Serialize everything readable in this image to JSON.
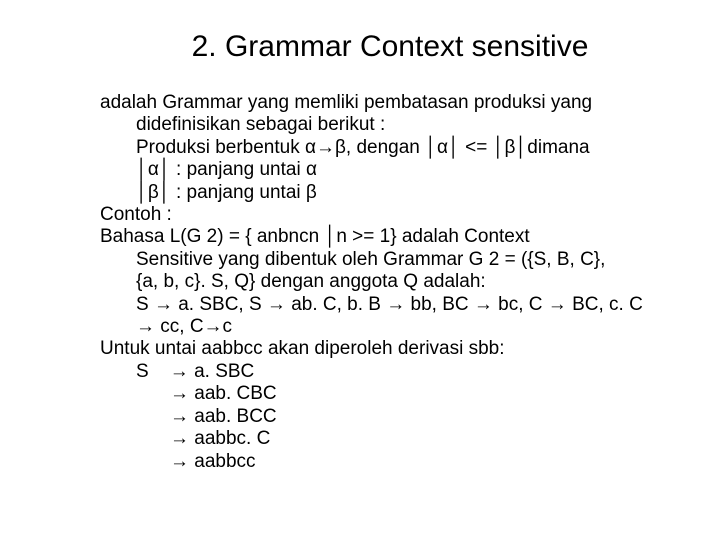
{
  "title": "2. Grammar Context sensitive",
  "lines": {
    "l1": "adalah Grammar yang memliki pembatasan produksi yang",
    "l2": "didefinisikan sebagai berikut :",
    "l3": "Produksi berbentuk α→β, dengan │α│ <= │β│dimana",
    "l4": "│α│ : panjang untai α",
    "l5": "│β│ : panjang untai β",
    "l6": "Contoh :",
    "l7": "Bahasa L(G 2) = { anbncn │n >= 1} adalah Context",
    "l8": "Sensitive yang dibentuk oleh Grammar G 2 = ({S, B, C},",
    "l9": "{a, b, c}. S, Q} dengan anggota Q adalah:",
    "l10": "S → a. SBC, S → ab. C, b. B → bb, BC → bc, C → BC, c. C",
    "l11": "→ cc, C→c",
    "l12": "Untuk untai aabbcc akan diperoleh derivasi sbb:",
    "d1": "S    → a. SBC",
    "d2": "→ aab. CBC",
    "d3": "→ aab. BCC",
    "d4": "→ aabbc. C",
    "d5": "→ aabbcc"
  }
}
